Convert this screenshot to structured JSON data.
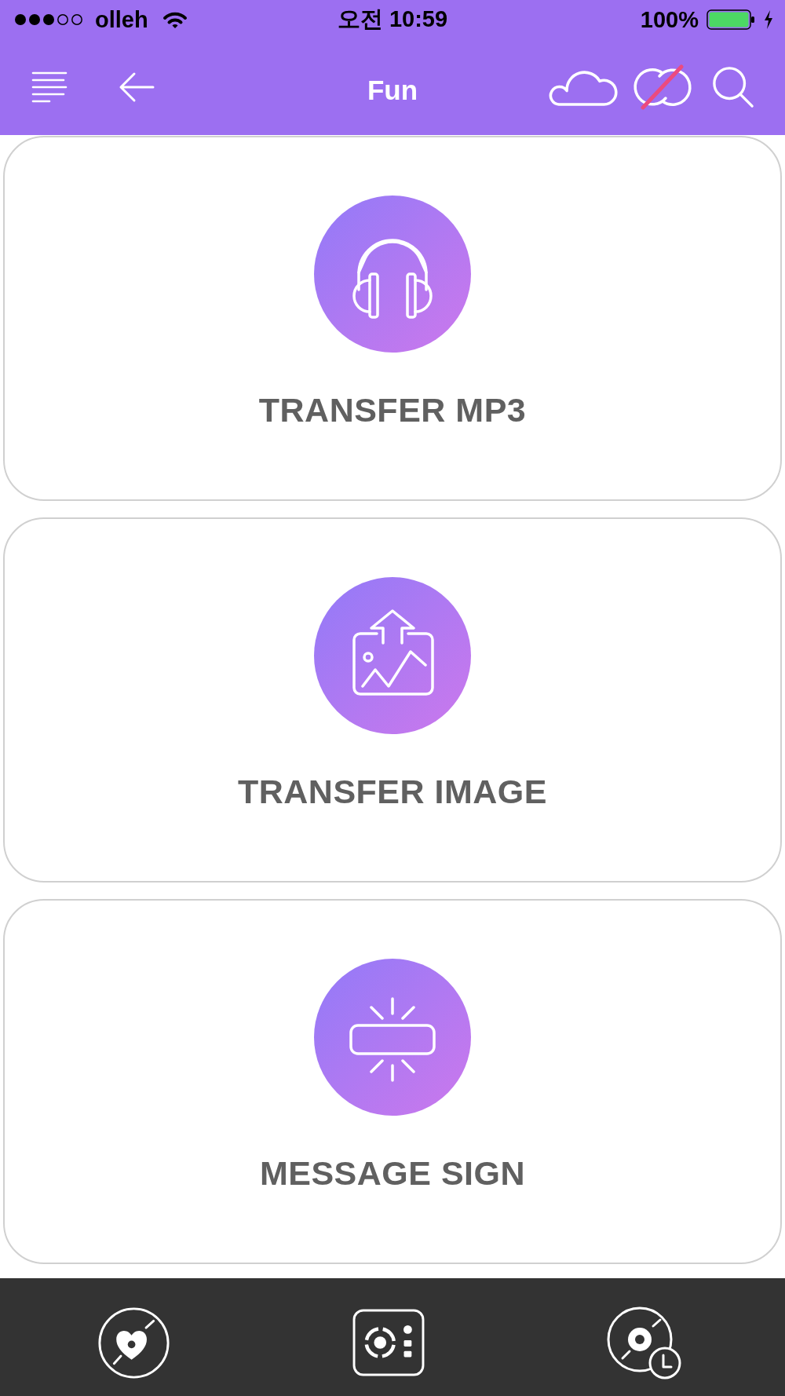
{
  "status_bar": {
    "carrier": "olleh",
    "time": "오전 10:59",
    "battery": "100%",
    "charging": true
  },
  "nav_bar": {
    "title": "Fun",
    "sync_on": false
  },
  "cards": [
    {
      "kind": "audio",
      "label": "TRANSFER MP3"
    },
    {
      "kind": "image",
      "label": "TRANSFER IMAGE"
    },
    {
      "kind": "sign",
      "label": "MESSAGE SIGN"
    }
  ]
}
